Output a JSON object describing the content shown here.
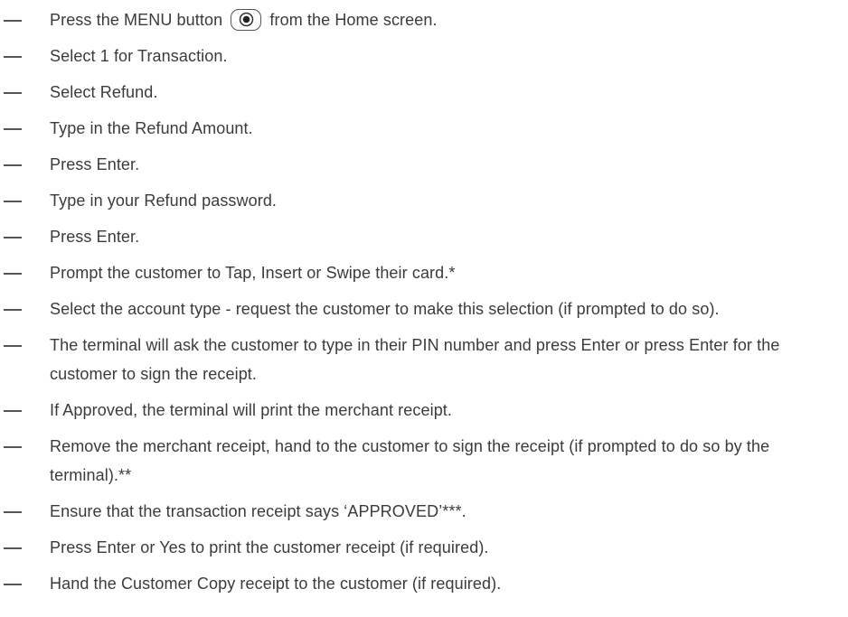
{
  "steps": [
    {
      "before": "Press the MENU button",
      "icon": "menu-button-icon",
      "after": "from the Home screen."
    },
    {
      "text": "Select 1 for Transaction."
    },
    {
      "text": "Select Refund."
    },
    {
      "text": "Type in the Refund Amount."
    },
    {
      "text": "Press Enter."
    },
    {
      "text": "Type in your Refund password."
    },
    {
      "text": "Press Enter."
    },
    {
      "text": "Prompt the customer to Tap, Insert or Swipe their card.*"
    },
    {
      "text": "Select the account type - request the customer to make this selection (if prompted to do so)."
    },
    {
      "text": "The terminal will ask the customer to type in their PIN number and press Enter or press Enter for the customer to sign the receipt."
    },
    {
      "text": "If Approved, the terminal will print the merchant receipt."
    },
    {
      "text": "Remove the merchant receipt, hand to the customer to sign the receipt (if prompted to do so by the terminal).**"
    },
    {
      "text": "Ensure that the transaction receipt says ‘APPROVED’***."
    },
    {
      "text": "Press Enter or Yes to print the customer receipt (if required)."
    },
    {
      "text": "Hand the Customer Copy receipt to the customer (if required)."
    }
  ]
}
